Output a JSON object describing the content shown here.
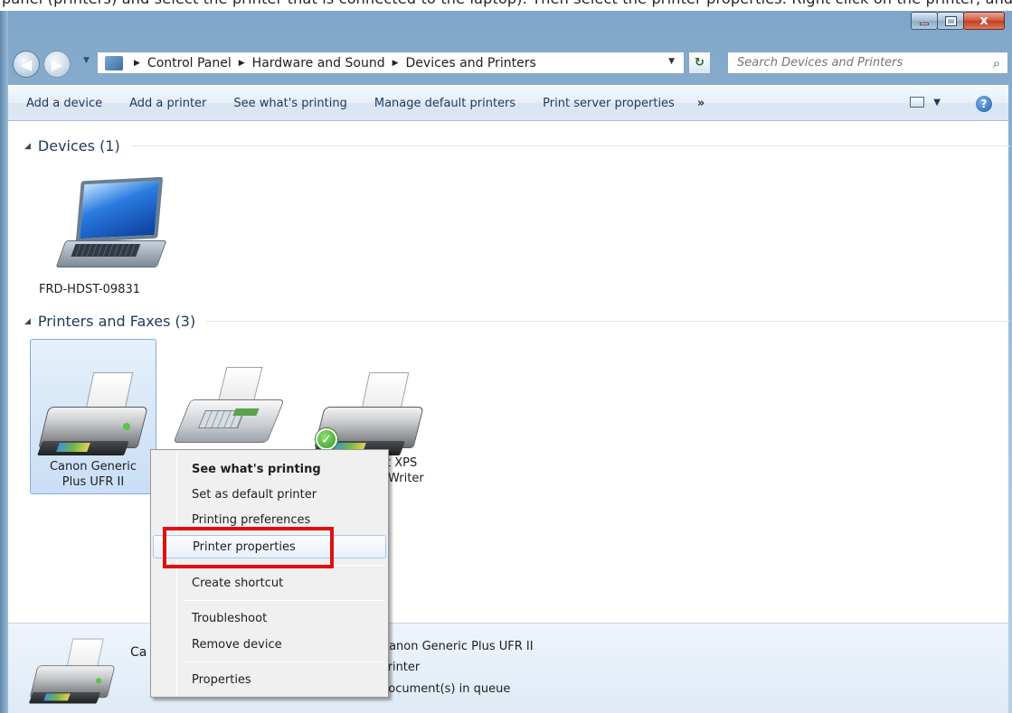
{
  "banner": {
    "text": "panel (printers) and select the printer that is connected to the laptop). Then select the printer properties. Right click on the printer, and select printer prop"
  },
  "window": {
    "close_glyph": "x"
  },
  "address": {
    "crumbs": [
      "Control Panel",
      "Hardware and Sound",
      "Devices and Printers"
    ],
    "search_placeholder": "Search Devices and Printers"
  },
  "toolbar": {
    "add_device": "Add a device",
    "add_printer": "Add a printer",
    "see_printing": "See what's printing",
    "manage_default": "Manage default printers",
    "print_server": "Print server properties",
    "more": "»"
  },
  "groups": {
    "devices": "Devices (1)",
    "printers": "Printers and Faxes (3)"
  },
  "devices": [
    {
      "label": "FRD-HDST-09831",
      "icon": "laptop-icon"
    }
  ],
  "printers": [
    {
      "label_line1": "Canon Generic",
      "label_line2": "Plus UFR II",
      "icon": "printer-icon",
      "selected": true
    },
    {
      "label_line1": "",
      "label_line2": "",
      "icon": "fax-icon"
    },
    {
      "label_line1": "t XPS",
      "label_line2": "Writer",
      "icon": "printer-icon",
      "default": true
    }
  ],
  "context_menu": {
    "items": [
      {
        "label": "See what's printing",
        "bold": true
      },
      {
        "label": "Set as default printer"
      },
      {
        "label": "Printing preferences"
      },
      {
        "label": "Printer properties",
        "highlighted": true
      },
      {
        "label": "Create shortcut"
      },
      {
        "label": "Troubleshoot"
      },
      {
        "label": "Remove device"
      },
      {
        "label": "Properties"
      }
    ]
  },
  "details": {
    "name": "Ca",
    "model": "Canon Generic Plus UFR II",
    "category": "Printer",
    "status": "document(s) in queue"
  },
  "colors": {
    "annotation": "#e10f0f",
    "accent": "#1e395b"
  }
}
